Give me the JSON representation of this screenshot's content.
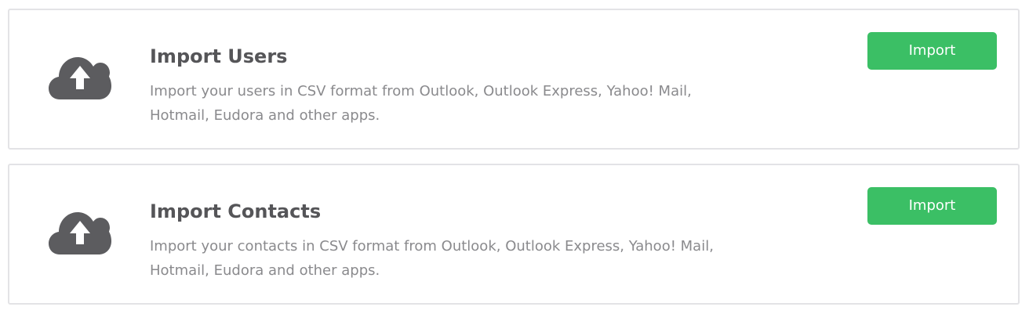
{
  "import_users": {
    "title": "Import Users",
    "description": "Import your users in CSV format from Outlook, Outlook Express, Yahoo! Mail, Hotmail, Eudora and other apps.",
    "button_label": "Import",
    "icon": "cloud-upload-icon"
  },
  "import_contacts": {
    "title": "Import Contacts",
    "description": "Import your contacts in CSV format from Outlook, Outlook Express, Yahoo! Mail, Hotmail, Eudora and other apps.",
    "button_label": "Import",
    "icon": "cloud-upload-icon"
  },
  "colors": {
    "button": "#3bbf65",
    "icon": "#5c5c5f",
    "title": "#555558",
    "description": "#8a8a8d",
    "card_border": "#e3e3e6"
  }
}
